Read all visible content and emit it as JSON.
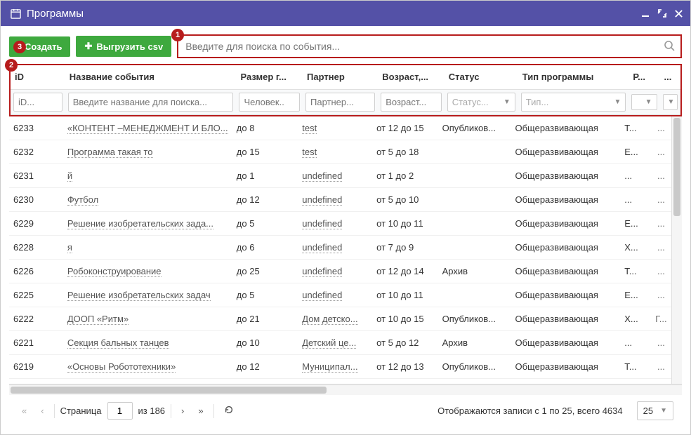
{
  "window": {
    "title": "Программы"
  },
  "toolbar": {
    "create_label": "Создать",
    "export_label": "Выгрузить csv",
    "search_placeholder": "Введите для поиска по события..."
  },
  "badges": {
    "b1": "1",
    "b2": "2",
    "b3": "3"
  },
  "columns": {
    "id": "iD",
    "name": "Название события",
    "size": "Размер г...",
    "partner": "Партнер",
    "age": "Возраст,...",
    "status": "Статус",
    "type": "Тип программы",
    "r": "Р...",
    "more": "..."
  },
  "filters": {
    "id_ph": "iD...",
    "name_ph": "Введите название для поиска...",
    "size_ph": "Человек..",
    "partner_ph": "Партнер...",
    "age_ph": "Возраст...",
    "status_ph": "Статус...",
    "type_ph": "Тип..."
  },
  "rows": [
    {
      "id": "6233",
      "name": "«КОНТЕНТ –МЕНЕДЖМЕНТ И БЛО...",
      "size": "до 8",
      "partner": "test",
      "age": "от 12 до 15",
      "status": "Опубликов...",
      "type": "Общеразвивающая",
      "r": "Т...",
      "m": "..."
    },
    {
      "id": "6232",
      "name": "Программа такая то",
      "size": "до 15",
      "partner": "test",
      "age": "от 5 до 18",
      "status": "",
      "type": "Общеразвивающая",
      "r": "Е...",
      "m": "..."
    },
    {
      "id": "6231",
      "name": "й",
      "size": "до 1",
      "partner": "undefined",
      "age": "от 1 до 2",
      "status": "",
      "type": "Общеразвивающая",
      "r": "...",
      "m": "..."
    },
    {
      "id": "6230",
      "name": "Футбол",
      "size": "до 12",
      "partner": "undefined",
      "age": "от 5 до 10",
      "status": "",
      "type": "Общеразвивающая",
      "r": "...",
      "m": "..."
    },
    {
      "id": "6229",
      "name": "Решение изобретательских зада...",
      "size": "до 5",
      "partner": "undefined",
      "age": "от 10 до 11",
      "status": "",
      "type": "Общеразвивающая",
      "r": "Е...",
      "m": "..."
    },
    {
      "id": "6228",
      "name": "я",
      "size": "до 6",
      "partner": "undefined",
      "age": "от 7 до 9",
      "status": "",
      "type": "Общеразвивающая",
      "r": "Х...",
      "m": "..."
    },
    {
      "id": "6226",
      "name": "Робоконструирование",
      "size": "до 25",
      "partner": "undefined",
      "age": "от 12 до 14",
      "status": "Архив",
      "type": "Общеразвивающая",
      "r": "Т...",
      "m": "..."
    },
    {
      "id": "6225",
      "name": "Решение изобретательских задач",
      "size": "до 5",
      "partner": "undefined",
      "age": "от 10 до 11",
      "status": "",
      "type": "Общеразвивающая",
      "r": "Е...",
      "m": "..."
    },
    {
      "id": "6222",
      "name": "ДООП «Ритм»",
      "size": "до 21",
      "partner": "Дом детско...",
      "age": "от 10 до 15",
      "status": "Опубликов...",
      "type": "Общеразвивающая",
      "r": "Х...",
      "m": "Г..."
    },
    {
      "id": "6221",
      "name": "Секция бальных танцев",
      "size": "до 10",
      "partner": "Детский це...",
      "age": "от 5 до 12",
      "status": "Архив",
      "type": "Общеразвивающая",
      "r": "...",
      "m": "..."
    },
    {
      "id": "6219",
      "name": "«Основы Робототехники»",
      "size": "до 12",
      "partner": "Муниципал...",
      "age": "от 12 до 13",
      "status": "Опубликов...",
      "type": "Общеразвивающая",
      "r": "Т...",
      "m": "..."
    }
  ],
  "pager": {
    "page_label": "Страница",
    "page": "1",
    "of_label": "из 186",
    "status": "Отображаются записи с 1 по 25, всего 4634",
    "perpage": "25"
  },
  "colors": {
    "accent": "#5451a7",
    "green": "#3ea93e",
    "redframe": "#b71c1c"
  }
}
